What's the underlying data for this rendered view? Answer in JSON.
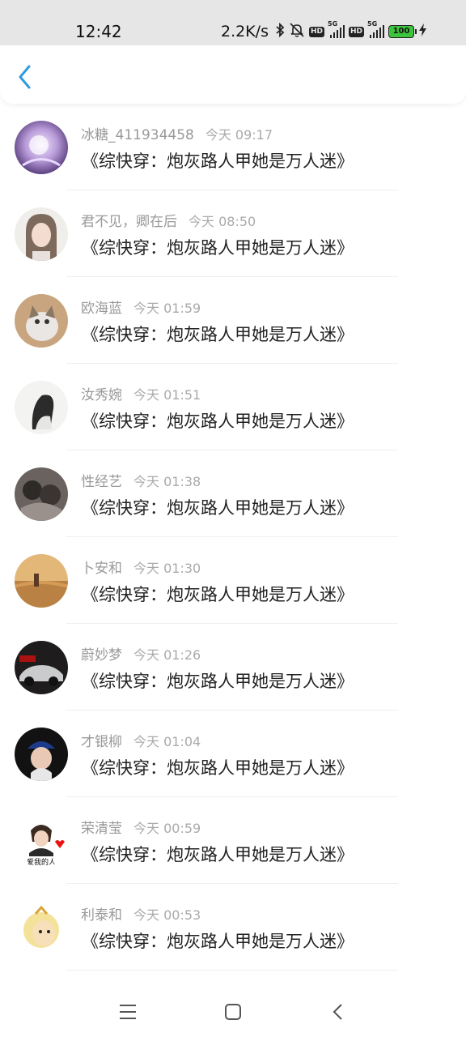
{
  "status_bar": {
    "time": "12:42",
    "net_speed": "2.2K/s",
    "battery": "100",
    "hd1": "HD",
    "hd2": "HD",
    "net1": "5G",
    "net2": "5G",
    "icons": [
      "bluetooth-icon",
      "mute-icon",
      "hd-icon",
      "signal-icon",
      "hd-icon",
      "signal-icon",
      "battery-icon",
      "charging-icon"
    ]
  },
  "header": {
    "back_icon": "chevron-left-icon",
    "accent": "#2f9bdf"
  },
  "items": [
    {
      "name": "冰糖_411934458",
      "time": "今天 09:17",
      "title": "《综快穿：炮灰路人甲她是万人迷》"
    },
    {
      "name": "君不见，卿在后",
      "time": "今天 08:50",
      "title": "《综快穿：炮灰路人甲她是万人迷》"
    },
    {
      "name": "欧海蓝",
      "time": "今天 01:59",
      "title": "《综快穿：炮灰路人甲她是万人迷》"
    },
    {
      "name": "汝秀婉",
      "time": "今天 01:51",
      "title": "《综快穿：炮灰路人甲她是万人迷》"
    },
    {
      "name": "性经艺",
      "time": "今天 01:38",
      "title": "《综快穿：炮灰路人甲她是万人迷》"
    },
    {
      "name": "卜安和",
      "time": "今天 01:30",
      "title": "《综快穿：炮灰路人甲她是万人迷》"
    },
    {
      "name": "蔚妙梦",
      "time": "今天 01:26",
      "title": "《综快穿：炮灰路人甲她是万人迷》"
    },
    {
      "name": "才银柳",
      "time": "今天 01:04",
      "title": "《综快穿：炮灰路人甲她是万人迷》"
    },
    {
      "name": "荣清莹",
      "time": "今天 00:59",
      "title": "《综快穿：炮灰路人甲她是万人迷》",
      "avatar_caption": "爱我的人"
    },
    {
      "name": "利泰和",
      "time": "今天 00:53",
      "title": "《综快穿：炮灰路人甲她是万人迷》"
    }
  ],
  "nav_bar": {
    "icons": [
      "menu-icon",
      "home-icon",
      "back-icon"
    ]
  }
}
